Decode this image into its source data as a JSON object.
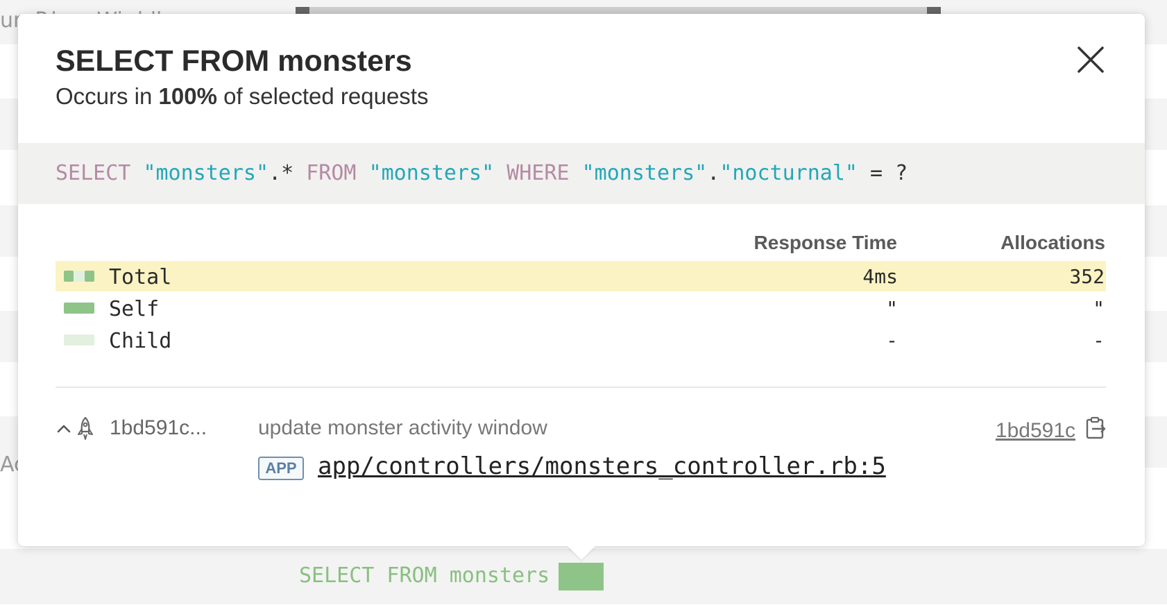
{
  "background": {
    "row_texts": [
      "ur· P.l:... ·Wi:ddl..",
      "Ac"
    ],
    "query_label": "SELECT FROM monsters"
  },
  "popover": {
    "title": "SELECT FROM monsters",
    "subtitle_prefix": "Occurs in ",
    "subtitle_percent": "100%",
    "subtitle_suffix": " of selected requests",
    "close_icon": "close-icon",
    "sql": {
      "kw_select": "SELECT",
      "t1": "\"monsters\"",
      "star": ".*",
      "kw_from": "FROM",
      "t2": "\"monsters\"",
      "kw_where": "WHERE",
      "t3": "\"monsters\"",
      "dot": ".",
      "t4": "\"nocturnal\"",
      "tail": " = ?"
    },
    "columns": {
      "response_time": "Response Time",
      "allocations": "Allocations"
    },
    "rows": [
      {
        "label": "Total",
        "response_time": "4ms",
        "allocations": "352"
      },
      {
        "label": "Self",
        "response_time": "\"",
        "allocations": "\""
      },
      {
        "label": "Child",
        "response_time": "-",
        "allocations": "-"
      }
    ],
    "trace": {
      "commit_short": "1bd591c...",
      "commit_message": "update monster activity window",
      "commit_link": "1bd591c",
      "badge": "APP",
      "file": "app/controllers/monsters_controller.rb:5"
    }
  },
  "colors": {
    "self_green": "#8ec487",
    "child_green": "#e3f0e0",
    "total_highlight": "#fbf3c4",
    "sql_keyword": "#b58aa3",
    "sql_string": "#22a7b8"
  }
}
